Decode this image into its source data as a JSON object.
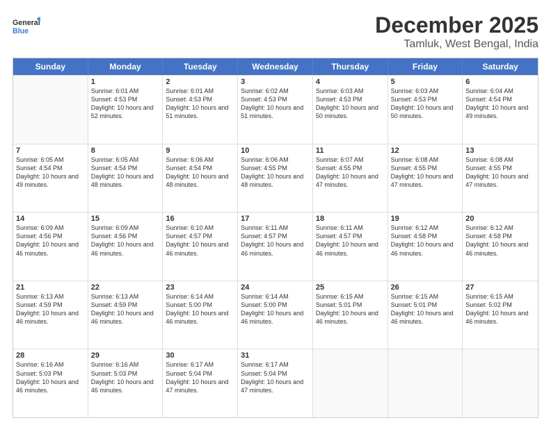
{
  "logo": {
    "general": "General",
    "blue": "Blue"
  },
  "title": "December 2025",
  "subtitle": "Tamluk, West Bengal, India",
  "header": {
    "days": [
      "Sunday",
      "Monday",
      "Tuesday",
      "Wednesday",
      "Thursday",
      "Friday",
      "Saturday"
    ]
  },
  "weeks": [
    [
      {
        "day": "",
        "sunrise": "",
        "sunset": "",
        "daylight": ""
      },
      {
        "day": "1",
        "sunrise": "Sunrise: 6:01 AM",
        "sunset": "Sunset: 4:53 PM",
        "daylight": "Daylight: 10 hours and 52 minutes."
      },
      {
        "day": "2",
        "sunrise": "Sunrise: 6:01 AM",
        "sunset": "Sunset: 4:53 PM",
        "daylight": "Daylight: 10 hours and 51 minutes."
      },
      {
        "day": "3",
        "sunrise": "Sunrise: 6:02 AM",
        "sunset": "Sunset: 4:53 PM",
        "daylight": "Daylight: 10 hours and 51 minutes."
      },
      {
        "day": "4",
        "sunrise": "Sunrise: 6:03 AM",
        "sunset": "Sunset: 4:53 PM",
        "daylight": "Daylight: 10 hours and 50 minutes."
      },
      {
        "day": "5",
        "sunrise": "Sunrise: 6:03 AM",
        "sunset": "Sunset: 4:53 PM",
        "daylight": "Daylight: 10 hours and 50 minutes."
      },
      {
        "day": "6",
        "sunrise": "Sunrise: 6:04 AM",
        "sunset": "Sunset: 4:54 PM",
        "daylight": "Daylight: 10 hours and 49 minutes."
      }
    ],
    [
      {
        "day": "7",
        "sunrise": "Sunrise: 6:05 AM",
        "sunset": "Sunset: 4:54 PM",
        "daylight": "Daylight: 10 hours and 49 minutes."
      },
      {
        "day": "8",
        "sunrise": "Sunrise: 6:05 AM",
        "sunset": "Sunset: 4:54 PM",
        "daylight": "Daylight: 10 hours and 48 minutes."
      },
      {
        "day": "9",
        "sunrise": "Sunrise: 6:06 AM",
        "sunset": "Sunset: 4:54 PM",
        "daylight": "Daylight: 10 hours and 48 minutes."
      },
      {
        "day": "10",
        "sunrise": "Sunrise: 6:06 AM",
        "sunset": "Sunset: 4:55 PM",
        "daylight": "Daylight: 10 hours and 48 minutes."
      },
      {
        "day": "11",
        "sunrise": "Sunrise: 6:07 AM",
        "sunset": "Sunset: 4:55 PM",
        "daylight": "Daylight: 10 hours and 47 minutes."
      },
      {
        "day": "12",
        "sunrise": "Sunrise: 6:08 AM",
        "sunset": "Sunset: 4:55 PM",
        "daylight": "Daylight: 10 hours and 47 minutes."
      },
      {
        "day": "13",
        "sunrise": "Sunrise: 6:08 AM",
        "sunset": "Sunset: 4:55 PM",
        "daylight": "Daylight: 10 hours and 47 minutes."
      }
    ],
    [
      {
        "day": "14",
        "sunrise": "Sunrise: 6:09 AM",
        "sunset": "Sunset: 4:56 PM",
        "daylight": "Daylight: 10 hours and 46 minutes."
      },
      {
        "day": "15",
        "sunrise": "Sunrise: 6:09 AM",
        "sunset": "Sunset: 4:56 PM",
        "daylight": "Daylight: 10 hours and 46 minutes."
      },
      {
        "day": "16",
        "sunrise": "Sunrise: 6:10 AM",
        "sunset": "Sunset: 4:57 PM",
        "daylight": "Daylight: 10 hours and 46 minutes."
      },
      {
        "day": "17",
        "sunrise": "Sunrise: 6:11 AM",
        "sunset": "Sunset: 4:57 PM",
        "daylight": "Daylight: 10 hours and 46 minutes."
      },
      {
        "day": "18",
        "sunrise": "Sunrise: 6:11 AM",
        "sunset": "Sunset: 4:57 PM",
        "daylight": "Daylight: 10 hours and 46 minutes."
      },
      {
        "day": "19",
        "sunrise": "Sunrise: 6:12 AM",
        "sunset": "Sunset: 4:58 PM",
        "daylight": "Daylight: 10 hours and 46 minutes."
      },
      {
        "day": "20",
        "sunrise": "Sunrise: 6:12 AM",
        "sunset": "Sunset: 4:58 PM",
        "daylight": "Daylight: 10 hours and 46 minutes."
      }
    ],
    [
      {
        "day": "21",
        "sunrise": "Sunrise: 6:13 AM",
        "sunset": "Sunset: 4:59 PM",
        "daylight": "Daylight: 10 hours and 46 minutes."
      },
      {
        "day": "22",
        "sunrise": "Sunrise: 6:13 AM",
        "sunset": "Sunset: 4:59 PM",
        "daylight": "Daylight: 10 hours and 46 minutes."
      },
      {
        "day": "23",
        "sunrise": "Sunrise: 6:14 AM",
        "sunset": "Sunset: 5:00 PM",
        "daylight": "Daylight: 10 hours and 46 minutes."
      },
      {
        "day": "24",
        "sunrise": "Sunrise: 6:14 AM",
        "sunset": "Sunset: 5:00 PM",
        "daylight": "Daylight: 10 hours and 46 minutes."
      },
      {
        "day": "25",
        "sunrise": "Sunrise: 6:15 AM",
        "sunset": "Sunset: 5:01 PM",
        "daylight": "Daylight: 10 hours and 46 minutes."
      },
      {
        "day": "26",
        "sunrise": "Sunrise: 6:15 AM",
        "sunset": "Sunset: 5:01 PM",
        "daylight": "Daylight: 10 hours and 46 minutes."
      },
      {
        "day": "27",
        "sunrise": "Sunrise: 6:15 AM",
        "sunset": "Sunset: 5:02 PM",
        "daylight": "Daylight: 10 hours and 46 minutes."
      }
    ],
    [
      {
        "day": "28",
        "sunrise": "Sunrise: 6:16 AM",
        "sunset": "Sunset: 5:03 PM",
        "daylight": "Daylight: 10 hours and 46 minutes."
      },
      {
        "day": "29",
        "sunrise": "Sunrise: 6:16 AM",
        "sunset": "Sunset: 5:03 PM",
        "daylight": "Daylight: 10 hours and 46 minutes."
      },
      {
        "day": "30",
        "sunrise": "Sunrise: 6:17 AM",
        "sunset": "Sunset: 5:04 PM",
        "daylight": "Daylight: 10 hours and 47 minutes."
      },
      {
        "day": "31",
        "sunrise": "Sunrise: 6:17 AM",
        "sunset": "Sunset: 5:04 PM",
        "daylight": "Daylight: 10 hours and 47 minutes."
      },
      {
        "day": "",
        "sunrise": "",
        "sunset": "",
        "daylight": ""
      },
      {
        "day": "",
        "sunrise": "",
        "sunset": "",
        "daylight": ""
      },
      {
        "day": "",
        "sunrise": "",
        "sunset": "",
        "daylight": ""
      }
    ]
  ]
}
